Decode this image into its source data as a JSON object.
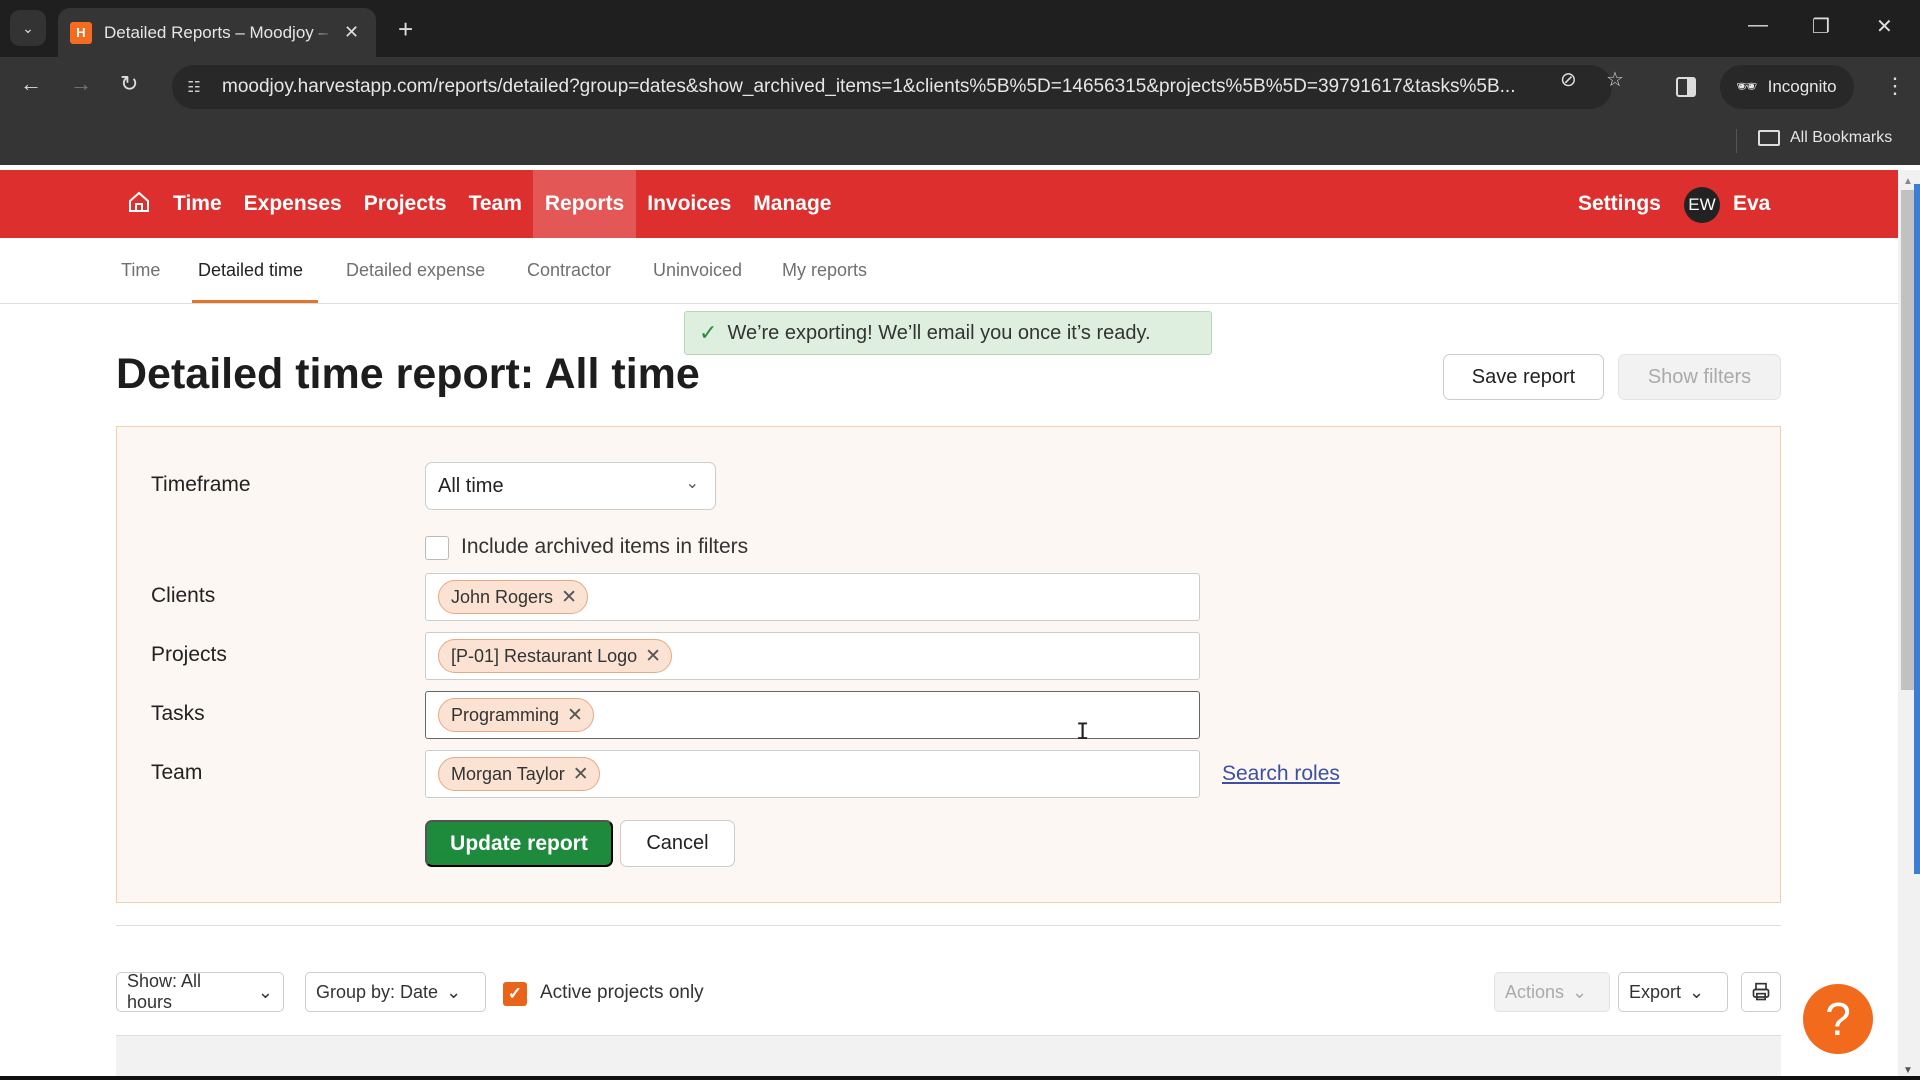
{
  "browser": {
    "tab_title": "Detailed Reports – Moodjoy – Harvest",
    "favicon_letter": "H",
    "url": "moodjoy.harvestapp.com/reports/detailed?group=dates&show_archived_items=1&clients%5B%5D=14656315&projects%5B%5D=39791617&tasks%5B...",
    "incognito_label": "Incognito",
    "bookmarks_label": "All Bookmarks"
  },
  "nav": {
    "items": [
      {
        "label": "Time",
        "active": false
      },
      {
        "label": "Expenses",
        "active": false
      },
      {
        "label": "Projects",
        "active": false
      },
      {
        "label": "Team",
        "active": false
      },
      {
        "label": "Reports",
        "active": true
      },
      {
        "label": "Invoices",
        "active": false
      },
      {
        "label": "Manage",
        "active": false
      }
    ],
    "settings_label": "Settings",
    "avatar_initials": "EW",
    "user_name": "Eva"
  },
  "subnav": {
    "items": [
      {
        "label": "Time"
      },
      {
        "label": "Detailed time"
      },
      {
        "label": "Detailed expense"
      },
      {
        "label": "Contractor"
      },
      {
        "label": "Uninvoiced"
      },
      {
        "label": "My reports"
      }
    ],
    "active_index": 1
  },
  "flash": {
    "message": "We’re exporting! We’ll email you once it’s ready."
  },
  "page": {
    "title": "Detailed time report: All time",
    "save_report_label": "Save report",
    "show_filters_label": "Show filters"
  },
  "filters": {
    "timeframe_label": "Timeframe",
    "timeframe_value": "All time",
    "archived_label": "Include archived items in filters",
    "archived_checked": false,
    "clients_label": "Clients",
    "clients": [
      "John Rogers"
    ],
    "projects_label": "Projects",
    "projects": [
      "[P-01] Restaurant Logo"
    ],
    "tasks_label": "Tasks",
    "tasks": [
      "Programming"
    ],
    "team_label": "Team",
    "team": [
      "Morgan Taylor"
    ],
    "search_roles_label": "Search roles",
    "update_label": "Update report",
    "cancel_label": "Cancel"
  },
  "controls": {
    "show_label": "Show: All hours",
    "group_label": "Group by: Date",
    "active_only_label": "Active projects only",
    "active_only_checked": true,
    "actions_label": "Actions",
    "export_label": "Export"
  },
  "help": {
    "glyph": "?"
  },
  "colors": {
    "nav_red": "#de2f2f",
    "nav_active": "#e45757",
    "primary_green": "#1d8a3c",
    "accent_orange": "#e8641b",
    "chip_bg": "#fbe2d3",
    "filter_bg": "#fdf7f3"
  }
}
